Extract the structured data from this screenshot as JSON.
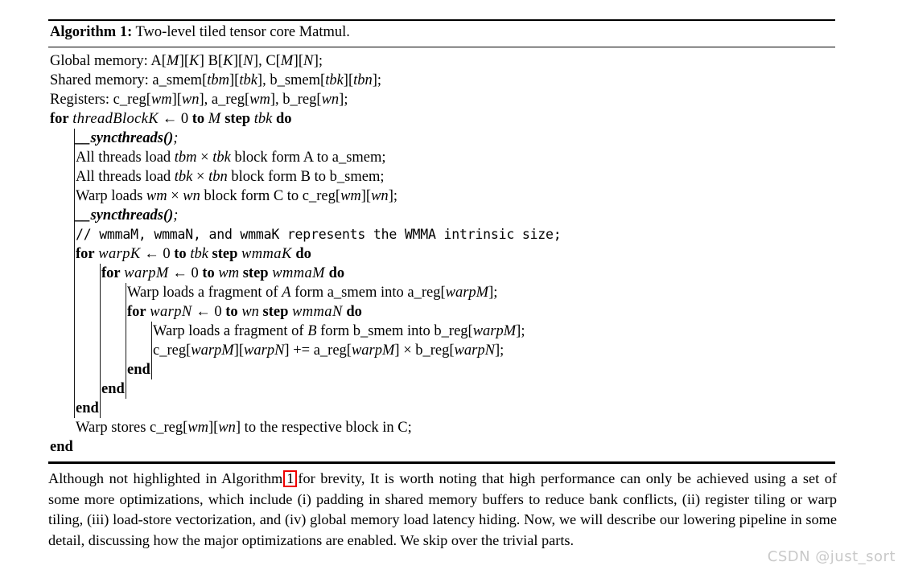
{
  "algorithm": {
    "caption_label": "Algorithm 1:",
    "caption_title": "Two-level tiled tensor core Matmul.",
    "lines": [
      {
        "id": "decl-global",
        "text": "Global memory: A[M][K] B[K][N], C[M][N];"
      },
      {
        "id": "decl-shared",
        "text": "Shared memory: a_smem[tbm][tbk], b_smem[tbk][tbn];"
      },
      {
        "id": "decl-registers",
        "text": "Registers: c_reg[wm][wn], a_reg[wm], b_reg[wn];"
      },
      {
        "id": "for-threadblockk",
        "text": "for threadBlockK ← 0 to M step tbk do"
      },
      {
        "id": "syncthreads-1",
        "text": "__syncthreads();"
      },
      {
        "id": "load-a-smem",
        "text": "All threads load tbm × tbk block form A to a_smem;"
      },
      {
        "id": "load-b-smem",
        "text": "All threads load tbk × tbn block form B to b_smem;"
      },
      {
        "id": "load-c-reg",
        "text": "Warp loads wm × wn block form C to c_reg[wm][wn];"
      },
      {
        "id": "syncthreads-2",
        "text": "__syncthreads();"
      },
      {
        "id": "comment-wmma",
        "text": "// wmmaM, wmmaN, and wmmaK represents the WMMA intrinsic size;"
      },
      {
        "id": "for-warpk",
        "text": "for warpK ← 0 to tbk step wmmaK do"
      },
      {
        "id": "for-warpm",
        "text": "for warpM ← 0 to wm step wmmaM do"
      },
      {
        "id": "load-frag-a",
        "text": "Warp loads a fragment of A form a_smem into a_reg[warpM];"
      },
      {
        "id": "for-warpn",
        "text": "for warpN ← 0 to wn step wmmaN do"
      },
      {
        "id": "load-frag-b",
        "text": "Warp loads a fragment of B form b_smem into b_reg[warpM];"
      },
      {
        "id": "mma-accumulate",
        "text": "c_reg[warpM][warpN] += a_reg[warpM] × b_reg[warpN];"
      },
      {
        "id": "end-warpn",
        "text": "end"
      },
      {
        "id": "end-warpm",
        "text": "end"
      },
      {
        "id": "end-warpk",
        "text": "end"
      },
      {
        "id": "store-c",
        "text": "Warp stores c_reg[wm][wn] to the respective block in C;"
      },
      {
        "id": "end-threadblockk",
        "text": "end"
      }
    ]
  },
  "paragraph": {
    "before_ref": "Although not highlighted in Algorithm",
    "ref": "1",
    "after_ref": "for brevity, It is worth noting that high performance can only be achieved using a set of some more optimizations, which include (i) padding in shared memory buffers to reduce bank conflicts, (ii) register tiling or warp tiling, (iii) load-store vectorization, and (iv) global memory load latency hiding. Now, we will describe our lowering pipeline in some detail, discussing how the major optimizations are enabled. We skip over the trivial parts."
  },
  "watermark": {
    "text": "CSDN @just_sort"
  },
  "colors": {
    "ref_box": "#ee0000",
    "rule": "#000000",
    "watermark": "#c9c9c9"
  }
}
